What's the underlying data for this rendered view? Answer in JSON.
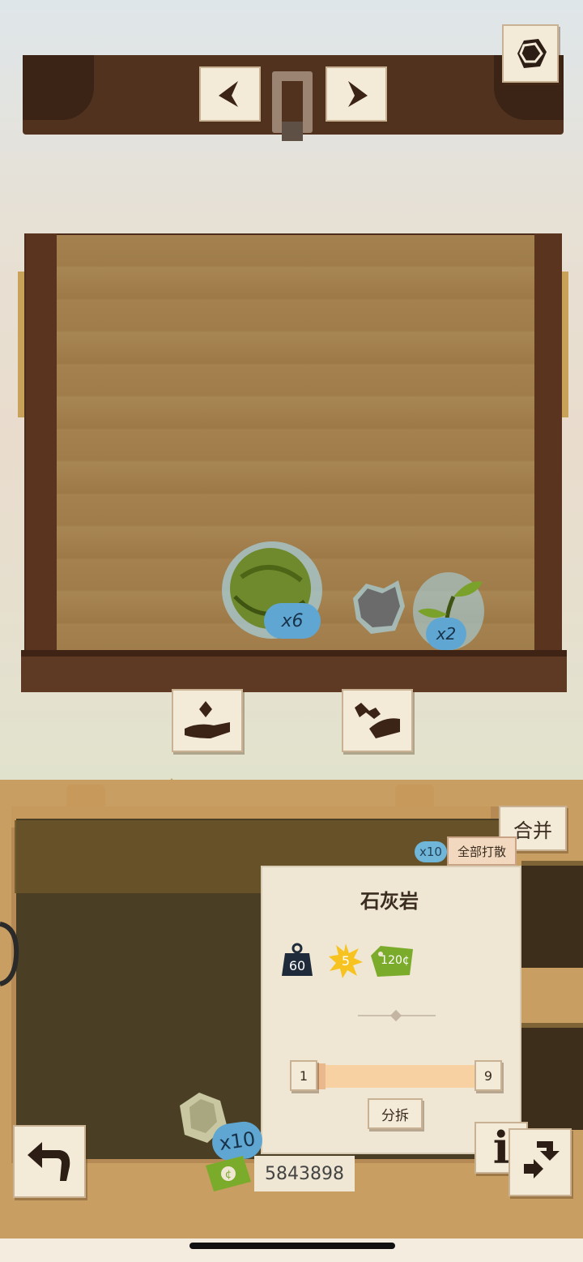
{
  "nav": {
    "prev_icon": "arrow-left-icon",
    "next_icon": "arrow-right-icon",
    "corner_icon": "ore-icon"
  },
  "crate": {
    "items": [
      {
        "icon": "green-ball-plant-icon",
        "count": "x6"
      },
      {
        "icon": "gray-stone-icon",
        "count": ""
      },
      {
        "icon": "sprout-icon",
        "count": "x2"
      }
    ]
  },
  "actions": {
    "take_icon": "hand-take-icon",
    "tool_icon": "hand-wrench-icon"
  },
  "bag": {
    "merge_label": "合并",
    "scatter_all_label": "全部打散",
    "scatter_count": "x10"
  },
  "card": {
    "title": "石灰岩",
    "weight": "60",
    "energy": "5",
    "price": "120¢",
    "slider_min": "1",
    "slider_max": "9",
    "split_label": "分拆"
  },
  "footer": {
    "back_icon": "back-arrow-icon",
    "info_icon": "info-icon",
    "info_label": "i",
    "swap_icon": "swap-icon",
    "stack_label": "x10",
    "money": "5843898"
  },
  "colors": {
    "wood_dark": "#51321f",
    "crate_floor": "#a4814f",
    "paper": "#f4ead8",
    "badge_blue": "#6fb6d8",
    "price_green": "#7bab2b",
    "energy_yellow": "#f7c321"
  }
}
